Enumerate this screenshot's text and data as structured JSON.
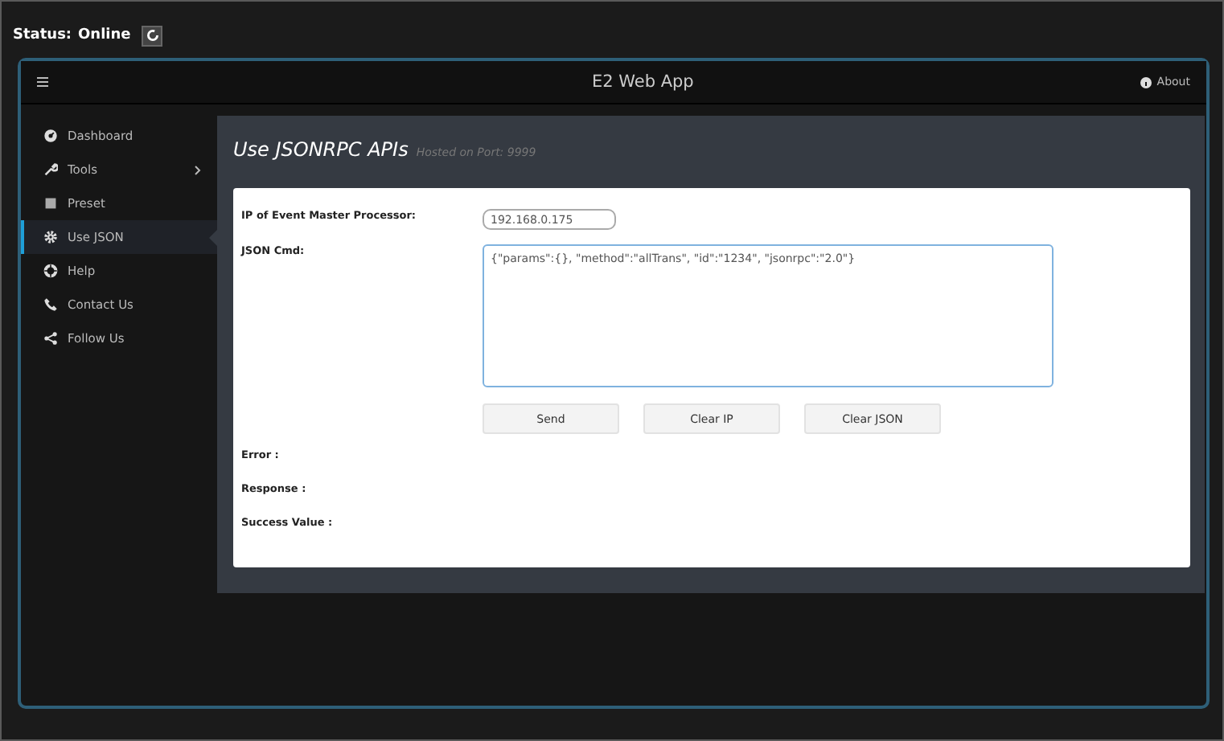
{
  "status": {
    "label": "Status:",
    "value": "Online"
  },
  "header": {
    "title": "E2 Web App",
    "about": "About"
  },
  "sidebar": {
    "items": [
      {
        "label": "Dashboard",
        "kind": "dashboard",
        "selected": false,
        "submenu": false
      },
      {
        "label": "Tools",
        "kind": "wrench",
        "selected": false,
        "submenu": true
      },
      {
        "label": "Preset",
        "kind": "square",
        "selected": false,
        "submenu": false
      },
      {
        "label": "Use JSON",
        "kind": "gear",
        "selected": true,
        "submenu": false
      },
      {
        "label": "Help",
        "kind": "lifebuoy",
        "selected": false,
        "submenu": false
      },
      {
        "label": "Contact Us",
        "kind": "phone",
        "selected": false,
        "submenu": false
      },
      {
        "label": "Follow Us",
        "kind": "share",
        "selected": false,
        "submenu": false
      }
    ]
  },
  "page": {
    "title": "Use JSONRPC APIs",
    "subtitle": "Hosted on Port: 9999"
  },
  "form": {
    "ip_label": "IP of Event Master Processor:",
    "ip_value": "192.168.0.175",
    "cmd_label": "JSON Cmd:",
    "cmd_value": "{\"params\":{}, \"method\":\"allTrans\", \"id\":\"1234\", \"jsonrpc\":\"2.0\"}",
    "buttons": [
      "Send",
      "Clear IP",
      "Clear JSON"
    ]
  },
  "results": [
    "Error :",
    "Response :",
    "Success Value :"
  ]
}
